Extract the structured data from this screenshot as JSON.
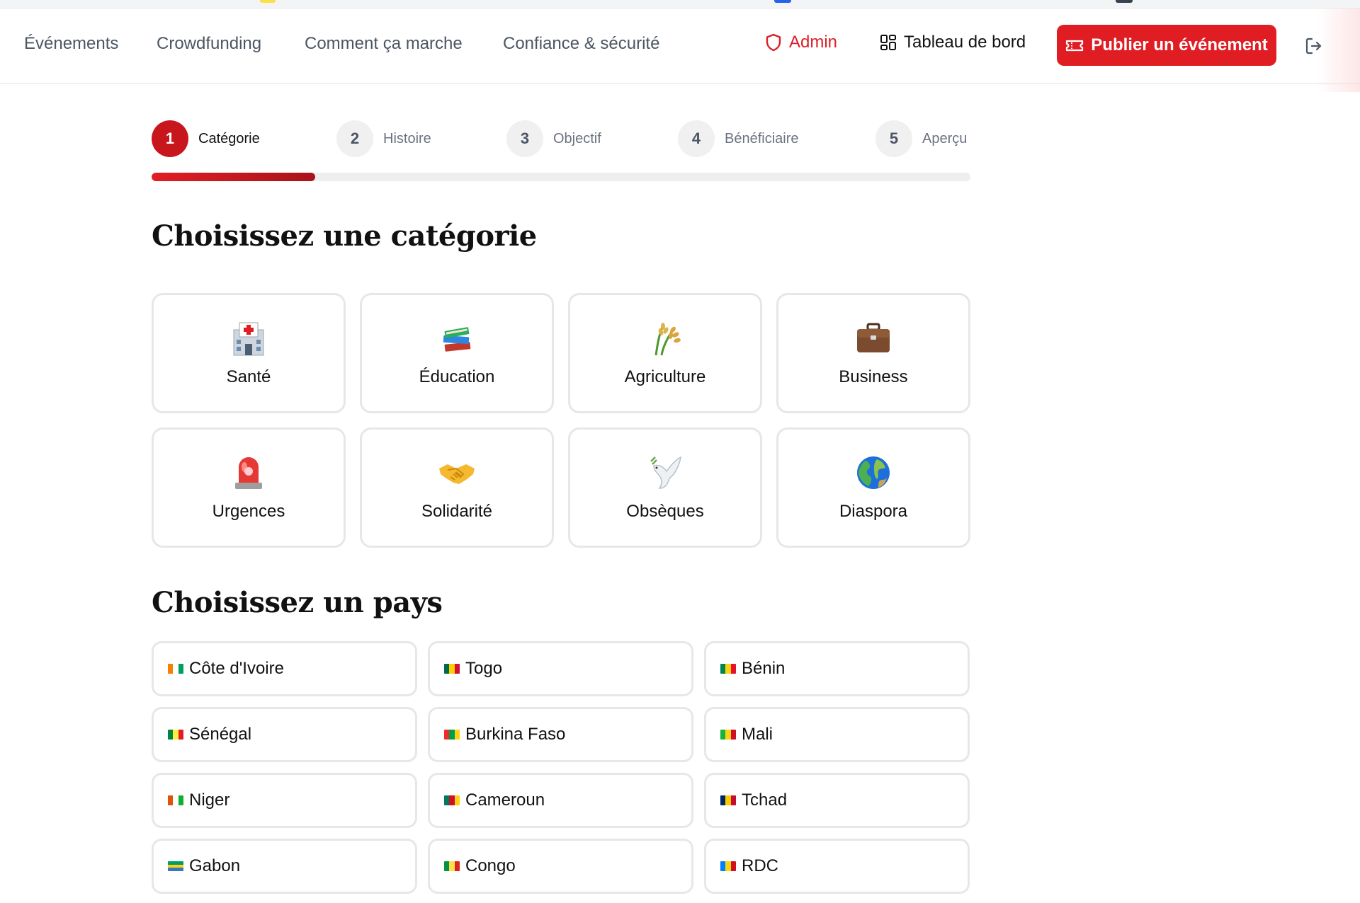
{
  "nav": {
    "links": [
      "Événements",
      "Crowdfunding",
      "Comment ça marche",
      "Confiance & sécurité"
    ],
    "admin_label": "Admin",
    "dashboard_label": "Tableau de bord",
    "publish_label": "Publier un événement"
  },
  "stepper": {
    "steps": [
      {
        "number": "1",
        "label": "Catégorie",
        "active": true
      },
      {
        "number": "2",
        "label": "Histoire",
        "active": false
      },
      {
        "number": "3",
        "label": "Objectif",
        "active": false
      },
      {
        "number": "4",
        "label": "Bénéficiaire",
        "active": false
      },
      {
        "number": "5",
        "label": "Aperçu",
        "active": false
      }
    ],
    "progress": 0.2
  },
  "category_section": {
    "title": "Choisissez une catégorie",
    "items": [
      {
        "label": "Santé",
        "icon": "hospital-icon"
      },
      {
        "label": "Éducation",
        "icon": "books-icon"
      },
      {
        "label": "Agriculture",
        "icon": "rice-icon"
      },
      {
        "label": "Business",
        "icon": "briefcase-icon"
      },
      {
        "label": "Urgences",
        "icon": "siren-icon"
      },
      {
        "label": "Solidarité",
        "icon": "handshake-icon"
      },
      {
        "label": "Obsèques",
        "icon": "dove-icon"
      },
      {
        "label": "Diaspora",
        "icon": "globe-icon"
      }
    ]
  },
  "country_section": {
    "title": "Choisissez un pays",
    "items": [
      {
        "label": "Côte d'Ivoire",
        "flag": [
          "#f77f00",
          "#ffffff",
          "#009e60"
        ]
      },
      {
        "label": "Togo",
        "flag": [
          "#006a4e",
          "#ffce00",
          "#d21034"
        ]
      },
      {
        "label": "Bénin",
        "flag": [
          "#008751",
          "#fcd116",
          "#e8112d"
        ]
      },
      {
        "label": "Sénégal",
        "flag": [
          "#00853f",
          "#fdef42",
          "#e31b23"
        ]
      },
      {
        "label": "Burkina Faso",
        "flag": [
          "#ef2b2d",
          "#009e49",
          "#fcd116"
        ]
      },
      {
        "label": "Mali",
        "flag": [
          "#14b53a",
          "#fcd116",
          "#ce1126"
        ]
      },
      {
        "label": "Niger",
        "flag": [
          "#e05206",
          "#ffffff",
          "#0db02b"
        ]
      },
      {
        "label": "Cameroun",
        "flag": [
          "#007a5e",
          "#ce1126",
          "#fcd116"
        ]
      },
      {
        "label": "Tchad",
        "flag": [
          "#002664",
          "#fecb00",
          "#c60c30"
        ]
      },
      {
        "label": "Gabon",
        "flag": [
          "#009e60",
          "#fcd116",
          "#3a75c4"
        ]
      },
      {
        "label": "Congo",
        "flag": [
          "#009543",
          "#fbde4a",
          "#dc241f"
        ]
      },
      {
        "label": "RDC",
        "flag": [
          "#007fff",
          "#f7d618",
          "#ce1021"
        ]
      }
    ]
  },
  "colors": {
    "brand": "#e11d24",
    "step_active": "#c8161d",
    "border": "#e5e7eb"
  }
}
